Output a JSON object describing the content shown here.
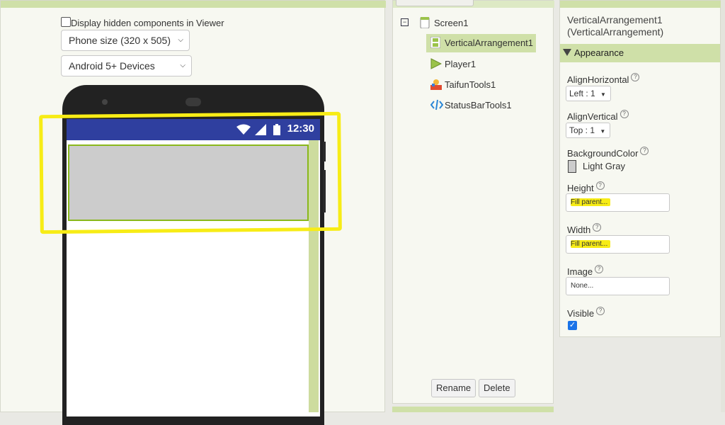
{
  "viewer": {
    "hidden_components_label": "Display hidden components in Viewer",
    "size_select": "Phone size (320 x 505)",
    "device_select": "Android 5+ Devices",
    "status_time": "12:30"
  },
  "tree": {
    "items": [
      {
        "label": "Screen1",
        "icon": "screen-icon"
      },
      {
        "label": "VerticalArrangement1",
        "icon": "vertical-arrangement-icon"
      },
      {
        "label": "Player1",
        "icon": "player-icon"
      },
      {
        "label": "TaifunTools1",
        "icon": "taifun-tools-icon"
      },
      {
        "label": "StatusBarTools1",
        "icon": "code-icon"
      }
    ],
    "rename_label": "Rename",
    "delete_label": "Delete"
  },
  "properties": {
    "title_line1": "VerticalArrangement1",
    "title_line2": "(VerticalArrangement)",
    "section": "Appearance",
    "align_horizontal_label": "AlignHorizontal",
    "align_horizontal_value": "Left : 1",
    "align_vertical_label": "AlignVertical",
    "align_vertical_value": "Top : 1",
    "background_color_label": "BackgroundColor",
    "background_color_value": "Light Gray",
    "height_label": "Height",
    "height_value": "Fill parent...",
    "width_label": "Width",
    "width_value": "Fill parent...",
    "image_label": "Image",
    "image_value": "None...",
    "visible_label": "Visible",
    "visible_checked": true
  },
  "colors": {
    "accent_green": "#cfe0a8",
    "status_bar": "#2f3f9f",
    "highlight_yellow": "#f7ec16",
    "selection_border": "#8ab81c"
  }
}
